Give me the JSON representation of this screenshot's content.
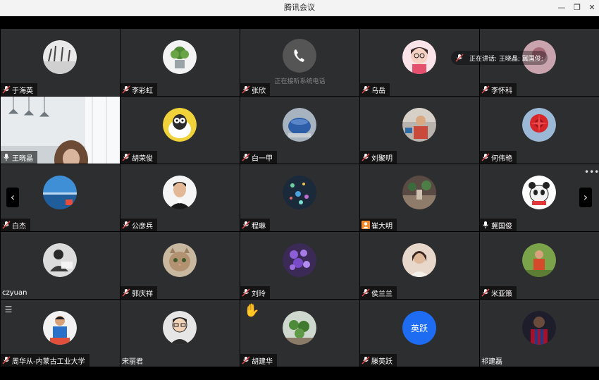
{
  "window": {
    "title": "腾讯会议",
    "min_label": "—",
    "max_label": "❐",
    "close_label": "✕"
  },
  "speaking": {
    "label": "正在讲话: 王晓晶; 冀国俊;"
  },
  "participants": [
    {
      "name": "于海英"
    },
    {
      "name": "李彩虹"
    },
    {
      "name": "张欣",
      "sub": "正在接听系统电话"
    },
    {
      "name": "乌岳"
    },
    {
      "name": "李怀科"
    },
    {
      "name": "王晓晶"
    },
    {
      "name": "胡荣俊"
    },
    {
      "name": "白一甲"
    },
    {
      "name": "刘聚明"
    },
    {
      "name": "何伟艳"
    },
    {
      "name": "白杰"
    },
    {
      "name": "公彦兵"
    },
    {
      "name": "程琳"
    },
    {
      "name": "崔大明"
    },
    {
      "name": "冀国俊"
    },
    {
      "name": "czyuan"
    },
    {
      "name": "郭庆祥"
    },
    {
      "name": "刘玲"
    },
    {
      "name": "侯兰兰"
    },
    {
      "name": "米亚策"
    },
    {
      "name": "周华从-内蒙古工业大学"
    },
    {
      "name": "宋丽君"
    },
    {
      "name": "胡建华"
    },
    {
      "name": "滕英跃",
      "avatar_text": "英跃"
    },
    {
      "name": "祁建磊"
    }
  ],
  "colors": {
    "tile_bg": "#2d2e30",
    "accent": "#1e6cf2",
    "mic_muted": "#e24b4b"
  },
  "nav": {
    "prev": "‹",
    "next": "›"
  }
}
